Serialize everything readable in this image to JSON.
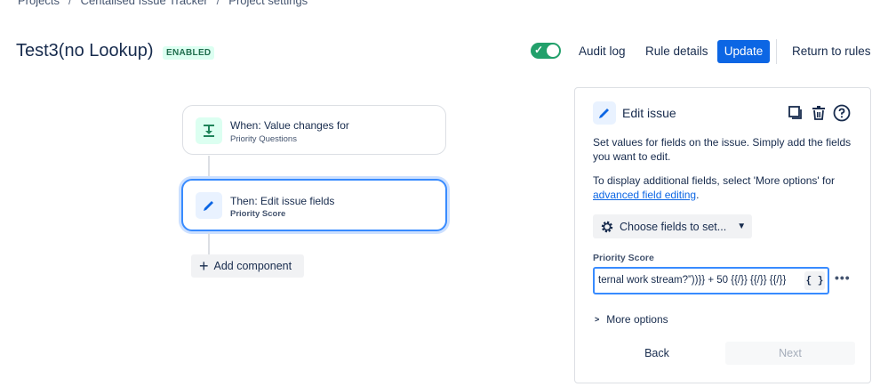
{
  "breadcrumb": {
    "items": [
      "Projects",
      "Centalised Issue Tracker",
      "Project settings"
    ],
    "separator": "/"
  },
  "header": {
    "title": "Test3(no Lookup)",
    "status": "ENABLED",
    "toggle_on": true,
    "audit_log": "Audit log",
    "rule_details": "Rule details",
    "update": "Update",
    "return": "Return to rules"
  },
  "canvas": {
    "trigger": {
      "title": "When: Value changes for",
      "subtitle": "Priority Questions"
    },
    "action": {
      "title": "Then: Edit issue fields",
      "subtitle": "Priority Score"
    },
    "add_component": "Add component"
  },
  "panel": {
    "title": "Edit issue",
    "description": "Set values for fields on the issue. Simply add the fields you want to edit.",
    "additional_prefix": "To display additional fields, select 'More options' for ",
    "additional_link": "advanced field editing",
    "additional_suffix": ".",
    "choose_fields": "Choose fields to set...",
    "field_label": "Priority Score",
    "field_value": "ternal work stream?”))}} + 50 {{/}} {{/}} {{/}}",
    "smart_value_button": "{ }",
    "more_options": "More options",
    "back": "Back",
    "next": "Next"
  },
  "colors": {
    "accent": "#0c66e4",
    "toggle": "#22a06b",
    "enabled_text": "#216e4e",
    "enabled_bg": "#dcfff1",
    "focus_border": "#388bff"
  }
}
